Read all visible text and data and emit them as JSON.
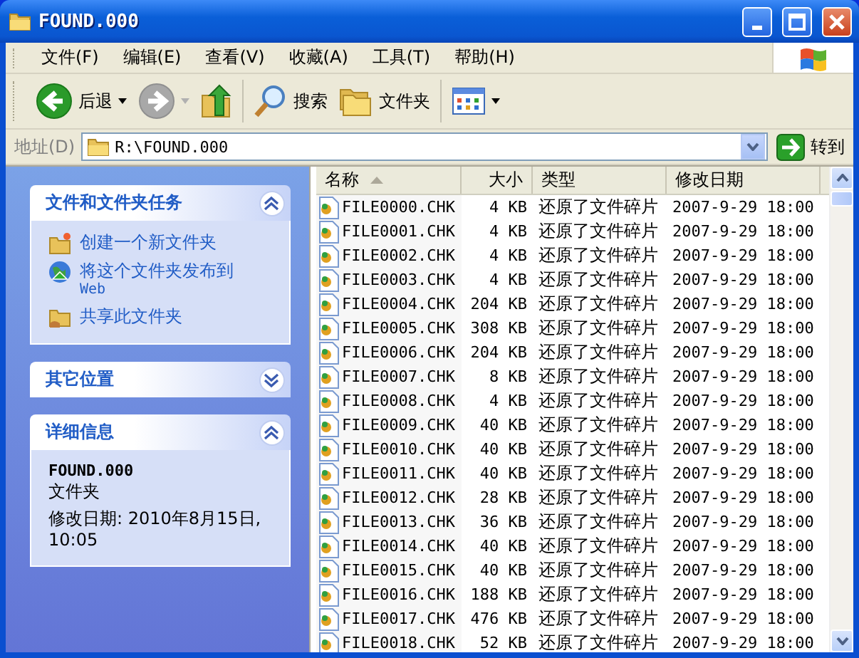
{
  "window": {
    "title": "FOUND.000"
  },
  "menu": [
    "文件(F)",
    "编辑(E)",
    "查看(V)",
    "收藏(A)",
    "工具(T)",
    "帮助(H)"
  ],
  "toolbar": [
    {
      "kind": "back",
      "label": "后退",
      "disabled": false
    },
    {
      "kind": "forward",
      "disabled": true
    },
    {
      "kind": "up"
    },
    {
      "kind": "search",
      "label": "搜索"
    },
    {
      "kind": "folders",
      "label": "文件夹"
    },
    {
      "kind": "views"
    }
  ],
  "address": {
    "label": "地址(D)",
    "value": "R:\\FOUND.000",
    "go": "转到"
  },
  "task_panels": [
    {
      "title": "文件和文件夹任务",
      "expanded": true,
      "kind": "links",
      "items": [
        {
          "kind": "new-folder",
          "text": "创建一个新文件夹"
        },
        {
          "kind": "globe",
          "text": "将这个文件夹发布到",
          "sub": "Web"
        },
        {
          "kind": "share",
          "text": "共享此文件夹"
        }
      ]
    },
    {
      "title": "其它位置",
      "expanded": false
    },
    {
      "title": "详细信息",
      "expanded": true,
      "kind": "details",
      "name": "FOUND.000",
      "type": "文件夹",
      "modified": "修改日期: 2010年8月15日, 10:05"
    }
  ],
  "table": {
    "columns": [
      {
        "label": "名称",
        "sorted": true
      },
      {
        "label": "大小",
        "sorted": false
      },
      {
        "label": "类型",
        "sorted": false
      },
      {
        "label": "修改日期",
        "sorted": false
      }
    ],
    "rows": [
      [
        "FILE0000.CHK",
        "4 KB",
        "还原了文件碎片",
        "2007-9-29 18:00"
      ],
      [
        "FILE0001.CHK",
        "4 KB",
        "还原了文件碎片",
        "2007-9-29 18:00"
      ],
      [
        "FILE0002.CHK",
        "4 KB",
        "还原了文件碎片",
        "2007-9-29 18:00"
      ],
      [
        "FILE0003.CHK",
        "4 KB",
        "还原了文件碎片",
        "2007-9-29 18:00"
      ],
      [
        "FILE0004.CHK",
        "204 KB",
        "还原了文件碎片",
        "2007-9-29 18:00"
      ],
      [
        "FILE0005.CHK",
        "308 KB",
        "还原了文件碎片",
        "2007-9-29 18:00"
      ],
      [
        "FILE0006.CHK",
        "204 KB",
        "还原了文件碎片",
        "2007-9-29 18:00"
      ],
      [
        "FILE0007.CHK",
        "8 KB",
        "还原了文件碎片",
        "2007-9-29 18:00"
      ],
      [
        "FILE0008.CHK",
        "4 KB",
        "还原了文件碎片",
        "2007-9-29 18:00"
      ],
      [
        "FILE0009.CHK",
        "40 KB",
        "还原了文件碎片",
        "2007-9-29 18:00"
      ],
      [
        "FILE0010.CHK",
        "40 KB",
        "还原了文件碎片",
        "2007-9-29 18:00"
      ],
      [
        "FILE0011.CHK",
        "40 KB",
        "还原了文件碎片",
        "2007-9-29 18:00"
      ],
      [
        "FILE0012.CHK",
        "28 KB",
        "还原了文件碎片",
        "2007-9-29 18:00"
      ],
      [
        "FILE0013.CHK",
        "36 KB",
        "还原了文件碎片",
        "2007-9-29 18:00"
      ],
      [
        "FILE0014.CHK",
        "40 KB",
        "还原了文件碎片",
        "2007-9-29 18:00"
      ],
      [
        "FILE0015.CHK",
        "40 KB",
        "还原了文件碎片",
        "2007-9-29 18:00"
      ],
      [
        "FILE0016.CHK",
        "188 KB",
        "还原了文件碎片",
        "2007-9-29 18:00"
      ],
      [
        "FILE0017.CHK",
        "476 KB",
        "还原了文件碎片",
        "2007-9-29 18:00"
      ],
      [
        "FILE0018.CHK",
        "52 KB",
        "还原了文件碎片",
        "2007-9-29 18:00"
      ]
    ]
  }
}
